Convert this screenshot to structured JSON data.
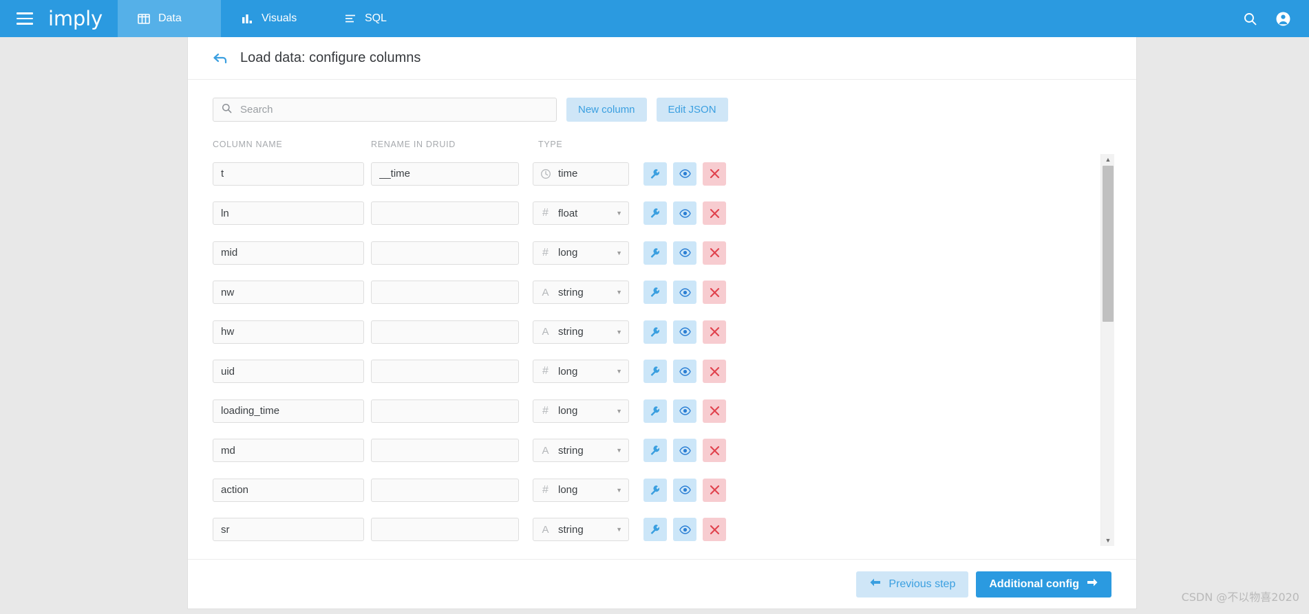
{
  "topbar": {
    "menu_icon": "hamburger-icon",
    "brand": "imply",
    "nav": [
      {
        "label": "Data",
        "icon": "table-icon",
        "active": true
      },
      {
        "label": "Visuals",
        "icon": "bar-chart-icon",
        "active": false
      },
      {
        "label": "SQL",
        "icon": "lines-icon",
        "active": false
      }
    ],
    "right_icons": [
      {
        "name": "search-icon"
      },
      {
        "name": "user-account-icon"
      }
    ],
    "brand_color": "#2b9ae0",
    "active_tab_color": "#55b0e8"
  },
  "header": {
    "back_icon": "back-arrow-icon",
    "title": "Load data: configure columns"
  },
  "toolbar": {
    "search_placeholder": "Search",
    "search_value": "",
    "search_icon": "search-icon",
    "new_column_label": "New column",
    "edit_json_label": "Edit JSON"
  },
  "table": {
    "headers": {
      "name": "COLUMN NAME",
      "rename": "RENAME IN DRUID",
      "type": "TYPE"
    },
    "action_icons": {
      "configure": "wrench-icon",
      "preview": "eye-icon",
      "remove": "close-x-icon"
    },
    "rows": [
      {
        "name": "t",
        "rename": "__time",
        "type": "time",
        "type_glyph": "clock-icon",
        "has_caret": false
      },
      {
        "name": "ln",
        "rename": "",
        "type": "float",
        "type_glyph": "hash-icon",
        "has_caret": true
      },
      {
        "name": "mid",
        "rename": "",
        "type": "long",
        "type_glyph": "hash-icon",
        "has_caret": true
      },
      {
        "name": "nw",
        "rename": "",
        "type": "string",
        "type_glyph": "A",
        "has_caret": true
      },
      {
        "name": "hw",
        "rename": "",
        "type": "string",
        "type_glyph": "A",
        "has_caret": true
      },
      {
        "name": "uid",
        "rename": "",
        "type": "long",
        "type_glyph": "hash-icon",
        "has_caret": true
      },
      {
        "name": "loading_time",
        "rename": "",
        "type": "long",
        "type_glyph": "hash-icon",
        "has_caret": true
      },
      {
        "name": "md",
        "rename": "",
        "type": "string",
        "type_glyph": "A",
        "has_caret": true
      },
      {
        "name": "action",
        "rename": "",
        "type": "long",
        "type_glyph": "hash-icon",
        "has_caret": true
      },
      {
        "name": "sr",
        "rename": "",
        "type": "string",
        "type_glyph": "A",
        "has_caret": true
      },
      {
        "name": "",
        "rename": "",
        "type": "",
        "type_glyph": "",
        "has_caret": false
      }
    ]
  },
  "scrollbar": {
    "up_arrow": "triangle-up-icon",
    "down_arrow": "triangle-down-icon"
  },
  "footer": {
    "previous_label": "Previous step",
    "previous_icon": "arrow-left-icon",
    "next_label": "Additional config",
    "next_icon": "arrow-right-icon"
  },
  "watermark": "CSDN @不以物喜2020"
}
